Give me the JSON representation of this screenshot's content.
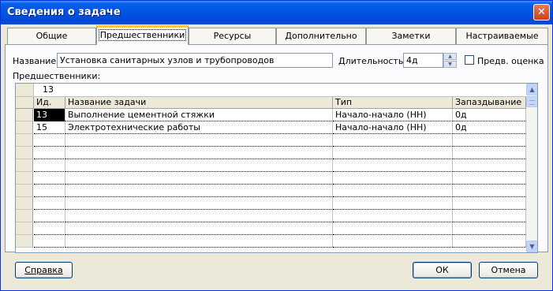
{
  "window": {
    "title": "Сведения о задаче",
    "close_icon": "close-icon"
  },
  "tabs": [
    {
      "label": "Общие",
      "active": false
    },
    {
      "label": "Предшественники",
      "active": true
    },
    {
      "label": "Ресурсы",
      "active": false
    },
    {
      "label": "Дополнительно",
      "active": false
    },
    {
      "label": "Заметки",
      "active": false
    },
    {
      "label": "Настраиваемые поля",
      "active": false
    }
  ],
  "form": {
    "name_label": "Название:",
    "name_value": "Установка санитарных узлов и трубопроводов",
    "duration_label": "Длительность:",
    "duration_value": "4д",
    "estimate_label": "Предв. оценка",
    "estimate_checked": false
  },
  "predecessors": {
    "label": "Предшественники:",
    "edit_value": "13",
    "columns": [
      "Ид.",
      "Название задачи",
      "Тип",
      "Запаздывание"
    ],
    "rows": [
      {
        "id": "13",
        "name": "Выполнение цементной стяжки",
        "type": "Начало-начало (НН)",
        "lag": "0д",
        "selected": true
      },
      {
        "id": "15",
        "name": "Электротехнические работы",
        "type": "Начало-начало (НН)",
        "lag": "0д",
        "selected": false
      }
    ],
    "empty_rows": 9
  },
  "buttons": {
    "help": "Справка",
    "ok": "ОК",
    "cancel": "Отмена"
  }
}
